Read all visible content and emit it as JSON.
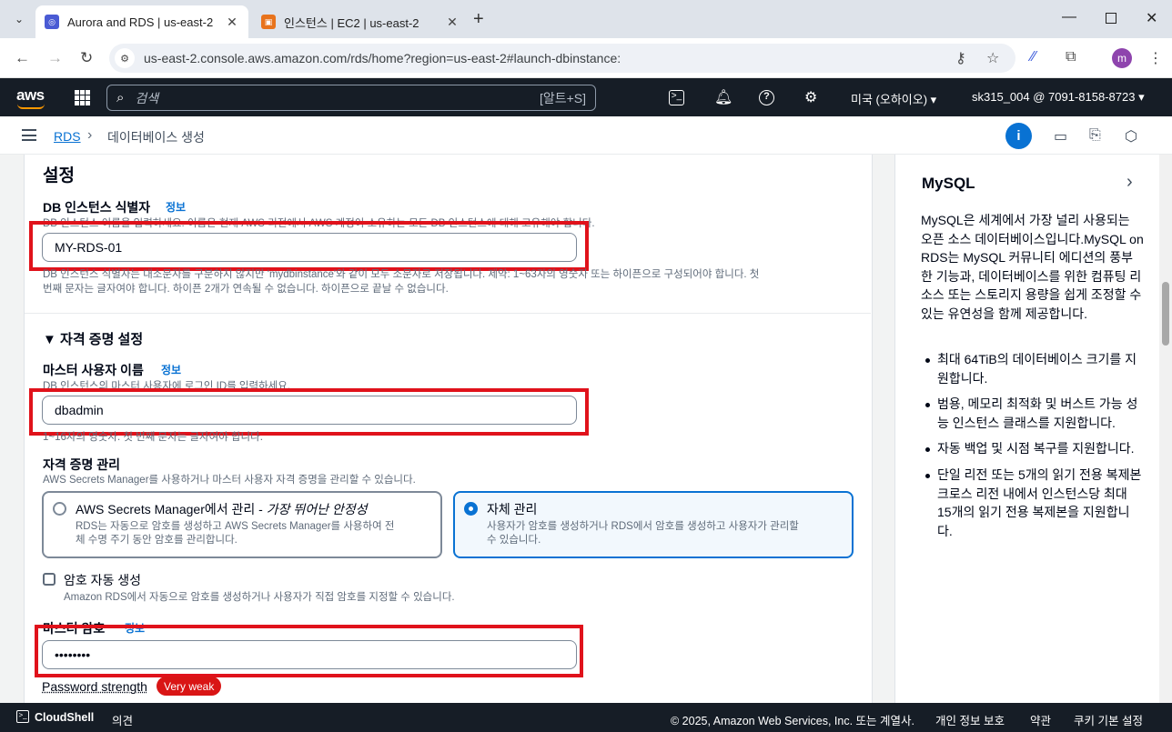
{
  "browser": {
    "tabs": [
      {
        "title": "Aurora and RDS | us-east-2",
        "favicon": "rds-favicon",
        "active": true
      },
      {
        "title": "인스턴스 | EC2 | us-east-2",
        "favicon": "ec2-favicon",
        "active": false
      }
    ],
    "url": "us-east-2.console.aws.amazon.com/rds/home?region=us-east-2#launch-dbinstance:",
    "profile_initial": "m"
  },
  "aws_nav": {
    "logo": "aws",
    "search_placeholder": "검색",
    "search_shortcut": "[알트+S]",
    "region": "미국 (오하이오)",
    "account": "sk315_004 @ 7091-8158-8723"
  },
  "breadcrumb": {
    "root": "RDS",
    "current": "데이터베이스 생성"
  },
  "form": {
    "section_title": "설정",
    "db_identifier": {
      "label": "DB 인스턴스 식별자",
      "info": "정보",
      "description": "DB 인스턴스 이름을 입력하세요. 이름은 현재 AWS 리전에서 AWS 계정이 소유하는 모든 DB 인스턴스에 대해 고유해야 합니다.",
      "value": "MY-RDS-01",
      "hint_line1": "DB 인스턴스 식별자는 대소문자를 구분하지 않지만 'mydbinstance'와 같이 모두 소문자로 저장됩니다. 제약: 1~63자의 영숫자 또는 하이픈으로 구성되어야 합니다. 첫",
      "hint_line2": "번째 문자는 글자여야 합니다. 하이픈 2개가 연속될 수 없습니다. 하이픈으로 끝날 수 없습니다."
    },
    "credentials": {
      "title": "자격 증명 설정",
      "master_username": {
        "label": "마스터 사용자 이름",
        "info": "정보",
        "description": "DB 인스턴스의 마스터 사용자에 로그인 ID를 입력하세요.",
        "value": "dbadmin",
        "hint": "1~16자의 영숫자. 첫 번째 문자는 글자여야 합니다."
      },
      "management": {
        "label": "자격 증명 관리",
        "description": "AWS Secrets Manager를 사용하거나 마스터 사용자 자격 증명을 관리할 수 있습니다.",
        "options": [
          {
            "title": "AWS Secrets Manager에서 관리 - ",
            "title_em": "가장 뛰어난 안정성",
            "desc_line1": "RDS는 자동으로 암호를 생성하고 AWS Secrets Manager를 사용하여 전",
            "desc_line2": "체 수명 주기 동안 암호를 관리합니다.",
            "selected": false
          },
          {
            "title": "자체 관리",
            "title_em": "",
            "desc_line1": "사용자가 암호를 생성하거나 RDS에서 암호를 생성하고 사용자가 관리할",
            "desc_line2": "수 있습니다.",
            "selected": true
          }
        ]
      },
      "auto_generate": {
        "label": "암호 자동 생성",
        "description": "Amazon RDS에서 자동으로 암호를 생성하거나 사용자가 직접 암호를 지정할 수 있습니다.",
        "checked": false
      },
      "master_password": {
        "label": "마스터 암호",
        "info": "정보",
        "value": "••••••••",
        "strength_label": "Password strength",
        "strength_value": "Very weak"
      }
    }
  },
  "help_panel": {
    "title": "MySQL",
    "paragraph": "MySQL은 세계에서 가장 널리 사용되는 오픈 소스 데이터베이스입니다.MySQL on RDS는 MySQL 커뮤니티 에디션의 풍부한 기능과, 데이터베이스를 위한 컴퓨팅 리소스 또는 스토리지 용량을 쉽게 조정할 수 있는 유연성을 함께 제공합니다.",
    "bullets": [
      "최대 64TiB의 데이터베이스 크기를 지원합니다.",
      "범용, 메모리 최적화 및 버스트 가능 성능 인스턴스 클래스를 지원합니다.",
      "자동 백업 및 시점 복구를 지원합니다.",
      "단일 리전 또는 5개의 읽기 전용 복제본 크로스 리전 내에서 인스턴스당 최대 15개의 읽기 전용 복제본을 지원합니다."
    ]
  },
  "footer": {
    "cloudshell": "CloudShell",
    "feedback": "의견",
    "copyright": "© 2025, Amazon Web Services, Inc. 또는 계열사.",
    "privacy": "개인 정보 보호",
    "terms": "약관",
    "cookies": "쿠키 기본 설정"
  },
  "colors": {
    "aws_nav_bg": "#161d26",
    "link": "#0972d3",
    "highlight_box": "#e0121b",
    "selected_tile": "#0972d3",
    "weak_badge": "#d91515"
  }
}
